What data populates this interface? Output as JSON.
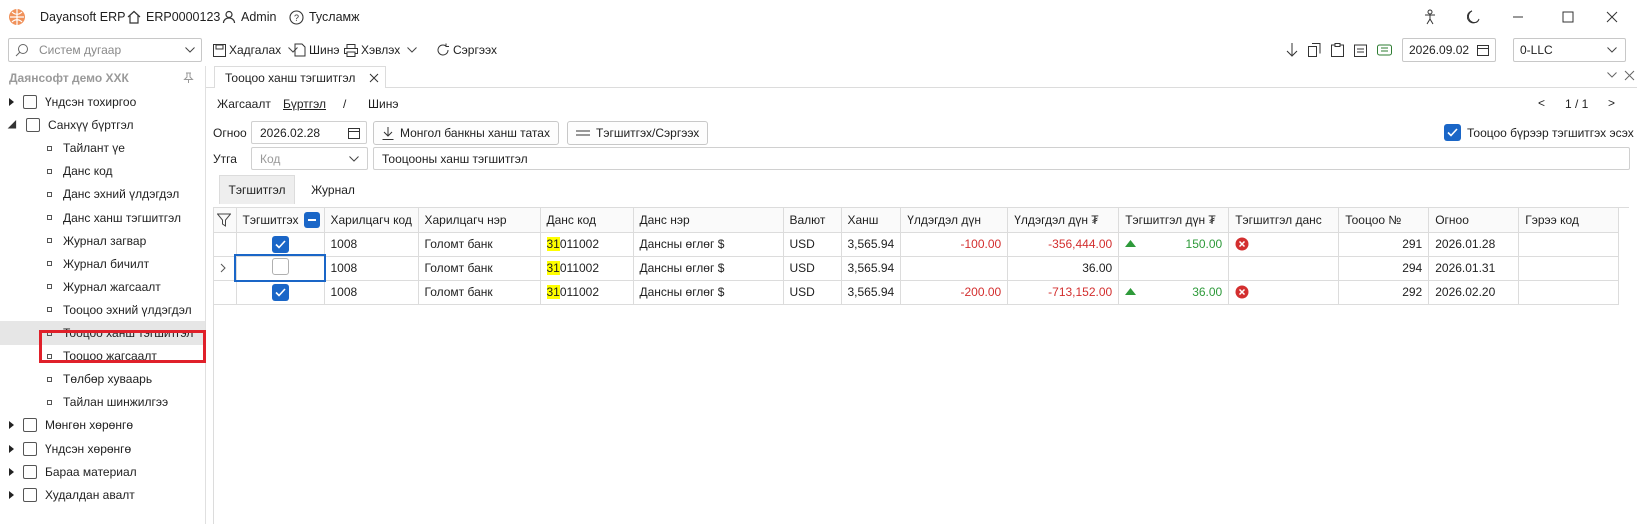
{
  "titlebar": {
    "app_name": "Dayansoft ERP",
    "code": "ERP0000123",
    "user": "Admin",
    "help": "Тусламж"
  },
  "toolbar": {
    "search_placeholder": "Систем дугаар",
    "save": "Хадгалах",
    "new": "Шинэ",
    "print": "Хэвлэх",
    "refresh": "Сэргээх",
    "date": "2026.09.02",
    "company_select": "0-LLC"
  },
  "sidebar": {
    "company": "Даянсофт демо ХХК",
    "items": [
      {
        "label": "Үндсэн тохиргоо",
        "level": 0
      },
      {
        "label": "Санхүү бүртгэл",
        "level": 0
      },
      {
        "label": "Тайлант үе",
        "level": 1
      },
      {
        "label": "Данс код",
        "level": 1
      },
      {
        "label": "Данс эхний үлдэгдэл",
        "level": 1
      },
      {
        "label": "Данс ханш тэгшитгэл",
        "level": 1
      },
      {
        "label": "Журнал загвар",
        "level": 1
      },
      {
        "label": "Журнал бичилт",
        "level": 1
      },
      {
        "label": "Журнал жагсаалт",
        "level": 1
      },
      {
        "label": "Тооцоо эхний үлдэгдэл",
        "level": 1
      },
      {
        "label": "Тооцоо ханш тэгшитгэл",
        "level": 1
      },
      {
        "label": "Тооцоо жагсаалт",
        "level": 1
      },
      {
        "label": "Төлбөр хуваарь",
        "level": 1
      },
      {
        "label": "Тайлан шинжилгээ",
        "level": 1
      },
      {
        "label": "Мөнгөн хөрөнгө",
        "level": 0
      },
      {
        "label": "Үндсэн хөрөнгө",
        "level": 0
      },
      {
        "label": "Бараа материал",
        "level": 0
      },
      {
        "label": "Худалдан авалт",
        "level": 0
      }
    ]
  },
  "doc": {
    "tab_title": "Тооцоо ханш тэгшитгэл",
    "nav_list": "Жагсаалт",
    "nav_register": "Бүртгэл",
    "nav_sep": "/",
    "nav_new": "Шинэ",
    "pager": "1 / 1",
    "date_label": "Огноо",
    "date_value": "2026.02.28",
    "btn_import": "Монгол банкны ханш татах",
    "btn_equalize": "Тэгшитгэх/Сэргээх",
    "chk_per_account": "Тооцоо бүрээр тэгшитгэх эсэх",
    "note_label": "Утга",
    "code_placeholder": "Код",
    "note_value": "Тооцооны ханш тэгшитгэл",
    "subtab_1": "Тэгшитгэл",
    "subtab_2": "Журнал"
  },
  "grid": {
    "columns": [
      "Тэгшитгэх",
      "Харилцагч код",
      "Харилцагч нэр",
      "Данс код",
      "Данс нэр",
      "Валют",
      "Ханш",
      "Үлдэгдэл дүн",
      "Үлдэгдэл дүн ₮",
      "Тэгшитгэл дүн ₮",
      "Тэгшитгэл данс",
      "Тооцоо №",
      "Огноо",
      "Гэрээ код"
    ],
    "rows": [
      {
        "checked": true,
        "partner_code": "1008",
        "partner_name": "Голомт банк",
        "acc_hl": "31",
        "acc_rest": "011002",
        "acc_name": "Дансны өглөг $",
        "currency": "USD",
        "rate": "3,565.94",
        "balance": "-100.00",
        "balance_mnt": "-356,444.00",
        "eq_amount": "150.00",
        "has_eq": true,
        "inv_no": "291",
        "date": "2026.01.28",
        "contract": ""
      },
      {
        "checked": false,
        "partner_code": "1008",
        "partner_name": "Голомт банк",
        "acc_hl": "31",
        "acc_rest": "011002",
        "acc_name": "Дансны өглөг $",
        "currency": "USD",
        "rate": "3,565.94",
        "balance": "",
        "balance_mnt": "36.00",
        "eq_amount": "",
        "has_eq": false,
        "inv_no": "294",
        "date": "2026.01.31",
        "contract": ""
      },
      {
        "checked": true,
        "partner_code": "1008",
        "partner_name": "Голомт банк",
        "acc_hl": "31",
        "acc_rest": "011002",
        "acc_name": "Дансны өглөг $",
        "currency": "USD",
        "rate": "3,565.94",
        "balance": "-200.00",
        "balance_mnt": "-713,152.00",
        "eq_amount": "36.00",
        "has_eq": true,
        "inv_no": "292",
        "date": "2026.02.20",
        "contract": ""
      }
    ]
  },
  "colors": {
    "accent": "#1a66c7",
    "negative": "#d32f2f",
    "positive": "#2e9a3a",
    "highlight": "#ffff00",
    "selection_box": "#e0202a"
  }
}
